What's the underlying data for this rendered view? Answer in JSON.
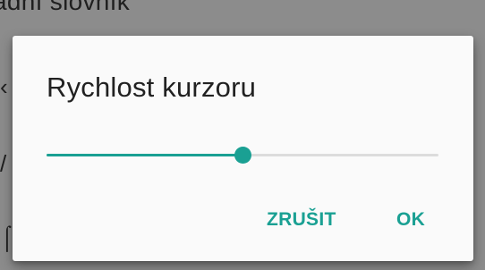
{
  "background": {
    "partial_text": "adní slovník"
  },
  "dialog": {
    "title": "Rychlost kurzoru",
    "slider": {
      "value_fraction": 0.5
    },
    "buttons": {
      "cancel": "ZRUŠIT",
      "ok": "OK"
    }
  },
  "colors": {
    "accent": "#1aa093",
    "track": "#dcdcdc",
    "dialog_background": "#fafafa",
    "scrim": "#8c8c8c",
    "title_text": "#212121"
  }
}
